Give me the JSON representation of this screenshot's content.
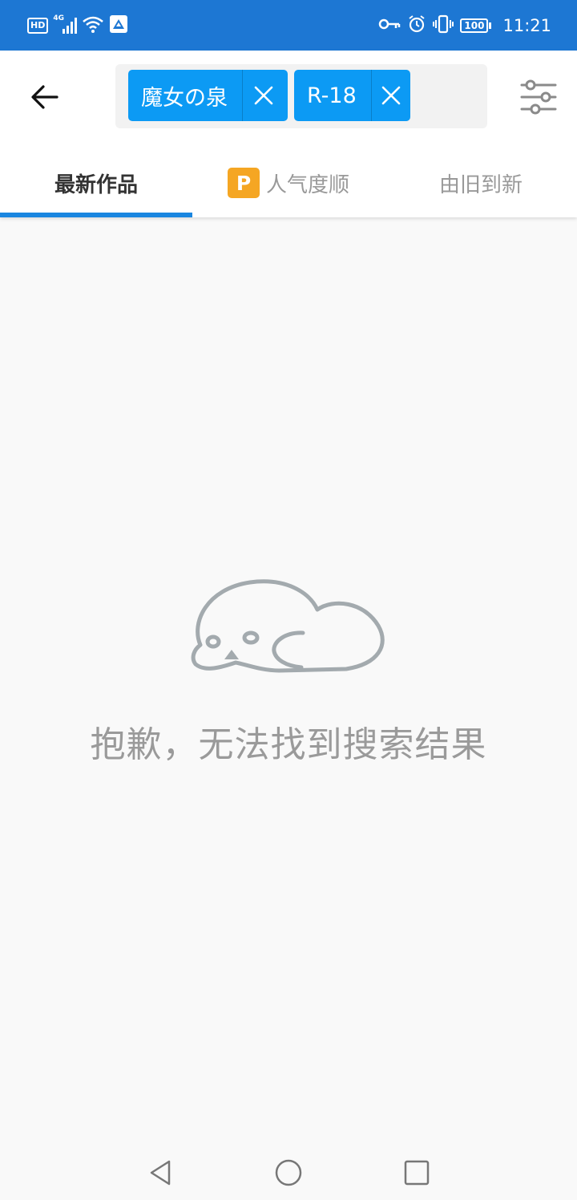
{
  "status_bar": {
    "left_icons": [
      "hd-icon",
      "signal-4g-icon",
      "wifi-icon",
      "app-notification-icon"
    ],
    "hd_label": "HD",
    "network_label": "4G",
    "right_icons": [
      "vpn-key-icon",
      "alarm-icon",
      "vibrate-icon",
      "battery-icon"
    ],
    "battery_level": "100",
    "time": "11:21"
  },
  "app_bar": {
    "back_icon": "arrow-left-icon",
    "tags": [
      {
        "label": "魔女の泉",
        "close_icon": "close-icon"
      },
      {
        "label": "R-18",
        "close_icon": "close-icon"
      }
    ],
    "filter_icon": "sliders-icon"
  },
  "tabs": [
    {
      "label": "最新作品",
      "active": true
    },
    {
      "label": "人气度顺",
      "active": false,
      "badge": "P"
    },
    {
      "label": "由旧到新",
      "active": false
    }
  ],
  "empty_state": {
    "illustration": "sleeping-seal-icon",
    "message": "抱歉，无法找到搜索结果"
  },
  "nav_bar": {
    "buttons": [
      "back-triangle-icon",
      "home-circle-icon",
      "recents-square-icon"
    ]
  },
  "colors": {
    "status_bar": "#1d77d3",
    "tag_bg": "#0c9af4",
    "tab_indicator": "#1a86e0",
    "premium_badge": "#f5a623",
    "background": "#f9f9f9"
  }
}
